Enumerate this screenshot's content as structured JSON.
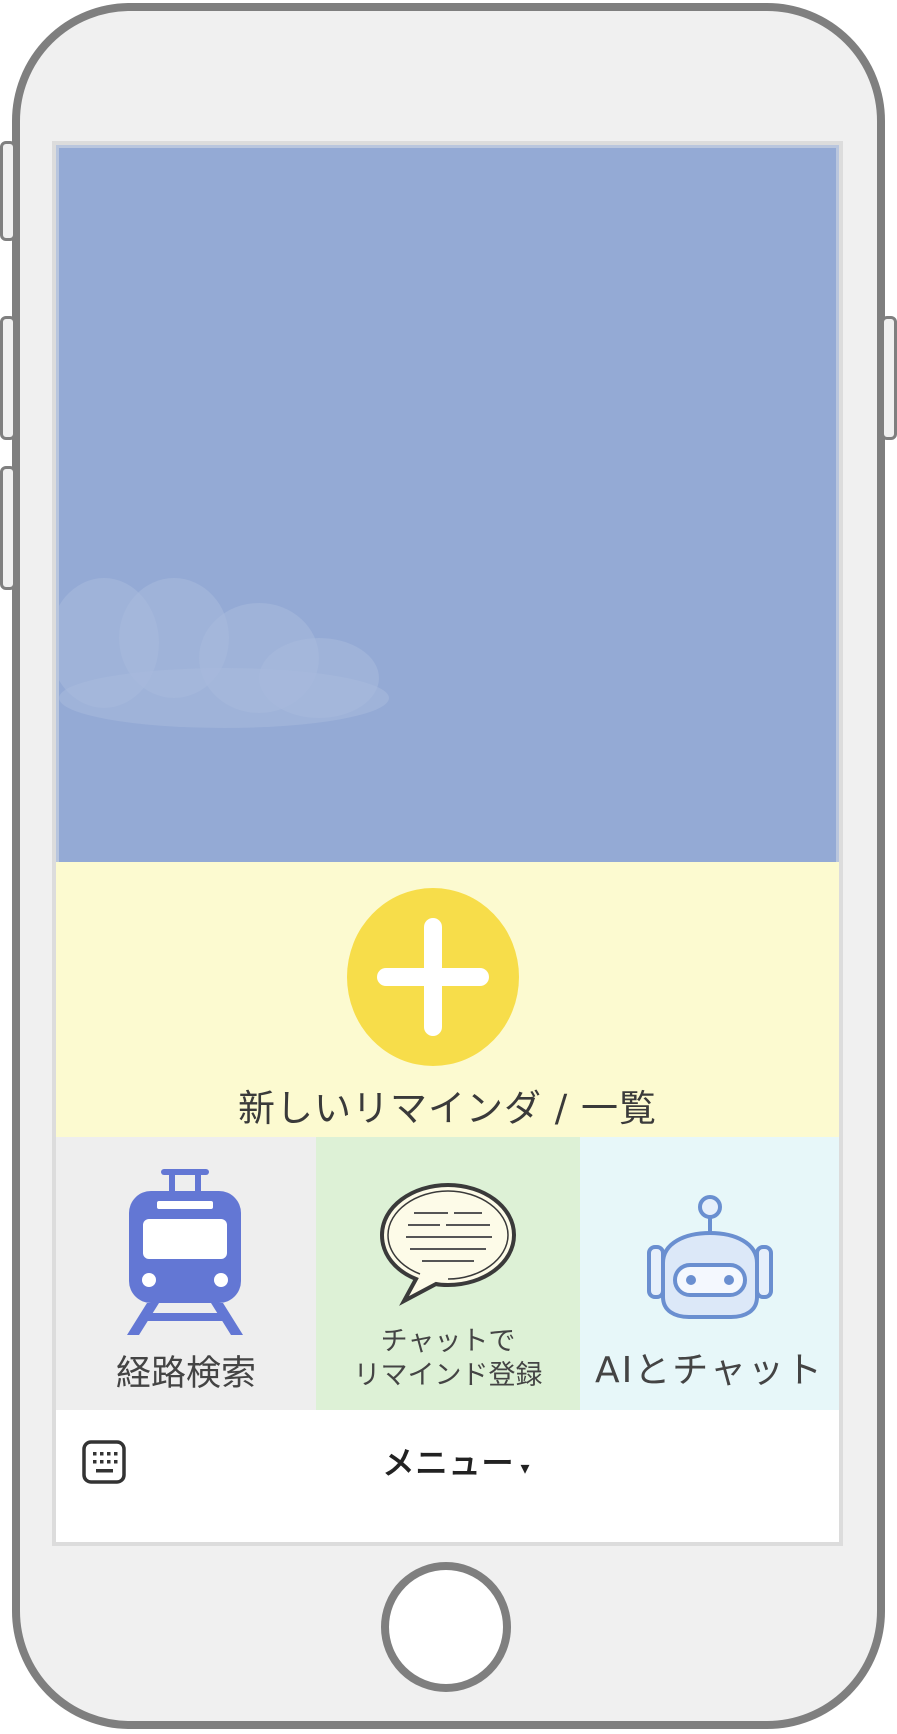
{
  "reminder": {
    "add_label": "新しいリマインダ / 一覧"
  },
  "tiles": {
    "route_label": "経路検索",
    "chat_label_line1": "チャットで",
    "chat_label_line2": "リマインド登録",
    "ai_label": "AIとチャット"
  },
  "menu": {
    "label": "メニュー",
    "caret": "▾"
  },
  "colors": {
    "banner": "#94aad5",
    "add_panel": "#fcfad0",
    "add_button": "#f7dd4a",
    "route_tile": "#eeeeee",
    "chat_tile": "#ddf1d6",
    "ai_tile": "#e7f7f9",
    "train_icon": "#6377d4"
  },
  "icons": {
    "add": "plus-icon",
    "route": "train-icon",
    "chat": "speech-bubble-icon",
    "ai": "robot-icon",
    "keyboard": "keyboard-icon",
    "caret": "caret-down-icon"
  }
}
